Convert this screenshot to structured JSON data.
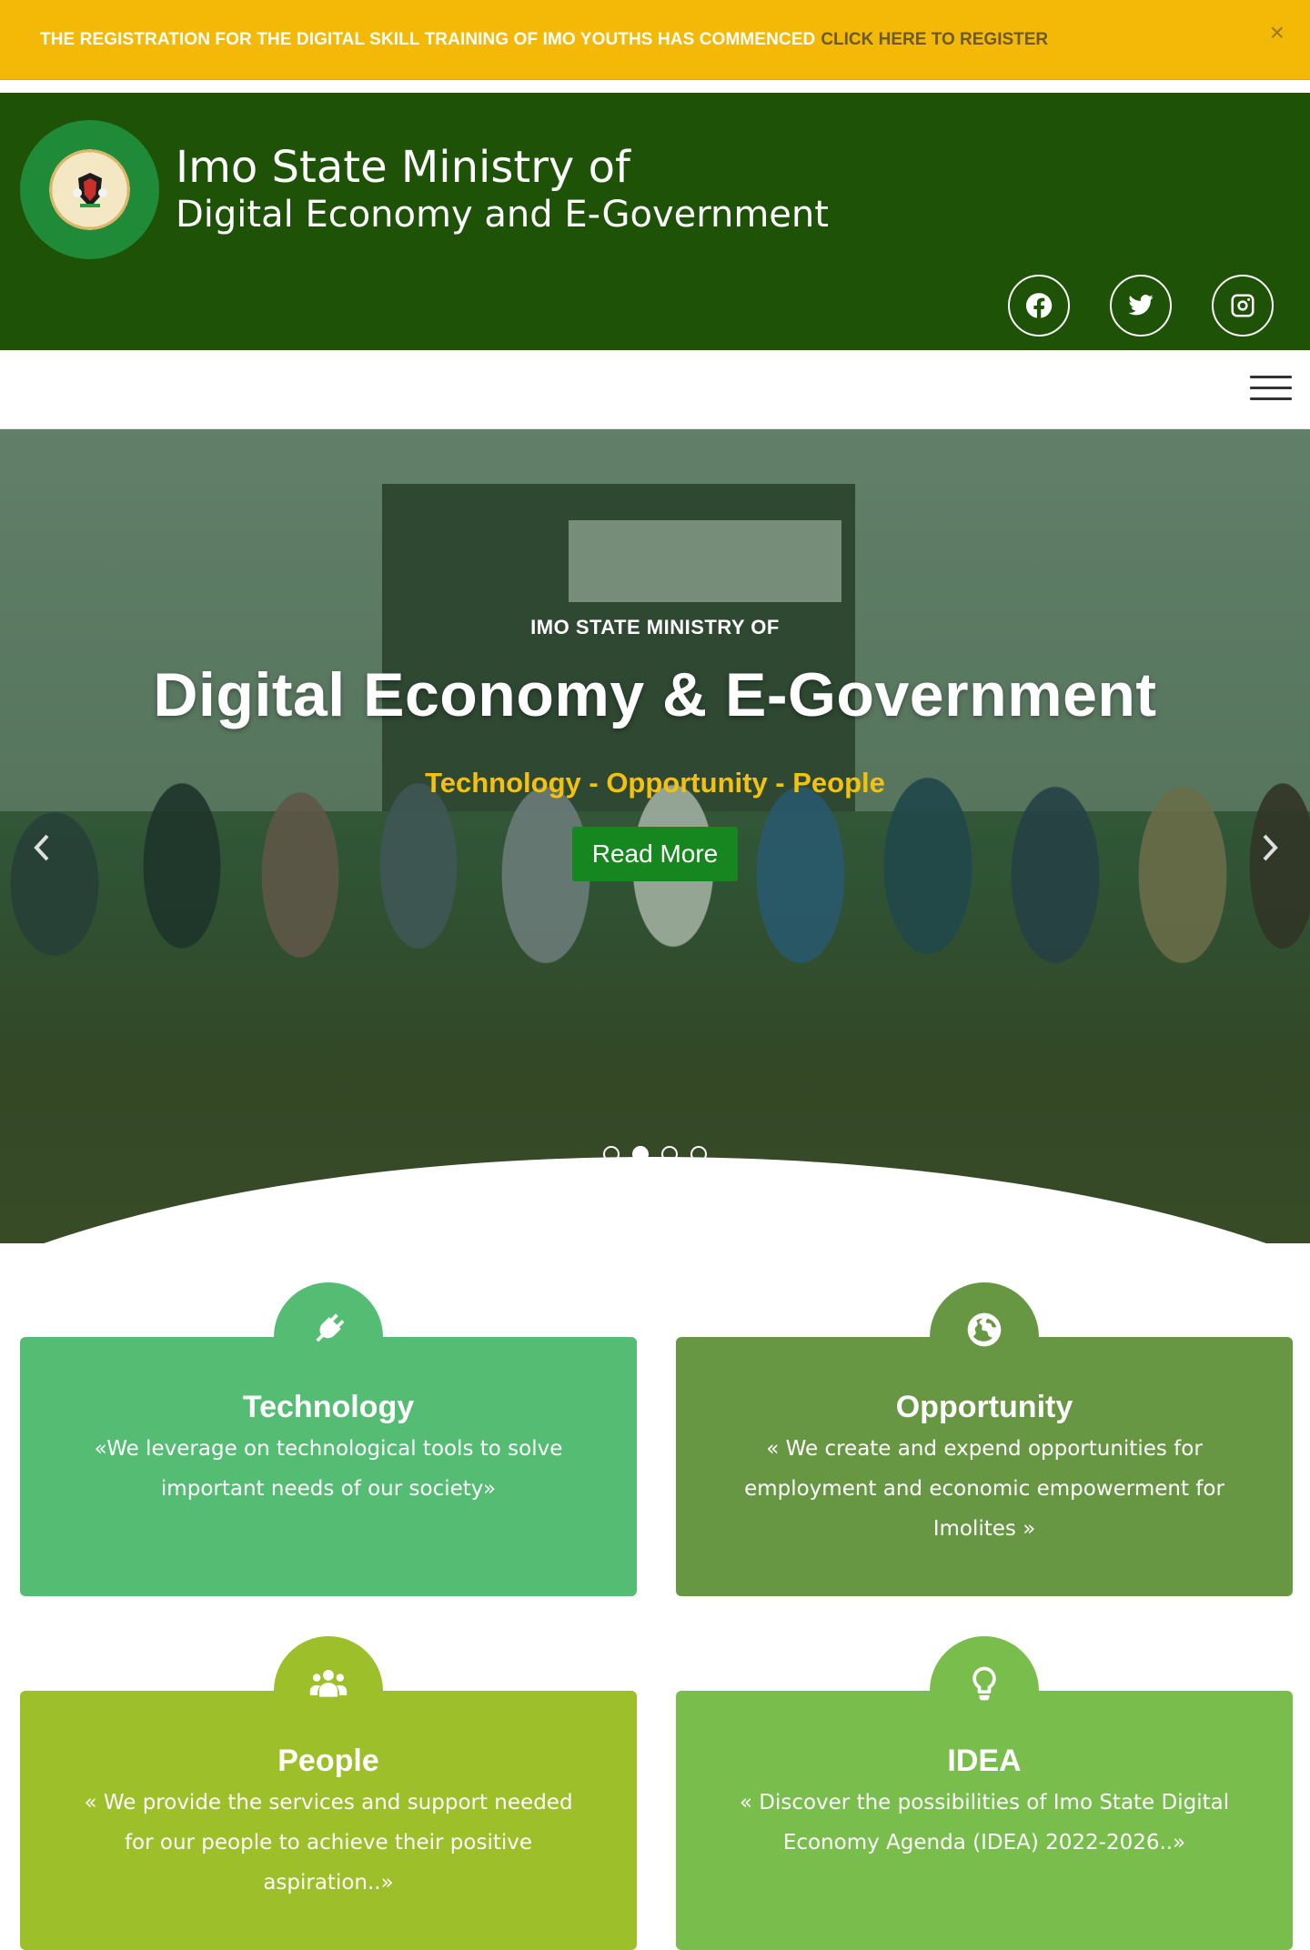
{
  "announcement": {
    "message": "THE REGISTRATION FOR THE DIGITAL SKILL TRAINING OF IMO YOUTHS HAS COMMENCED",
    "link_label": "CLICK HERE TO REGISTER",
    "close_label": "×"
  },
  "header": {
    "title_line1": "Imo State Ministry of",
    "title_line2": "Digital Economy and E-Government",
    "social": [
      "facebook-icon",
      "twitter-icon",
      "instagram-icon"
    ]
  },
  "hero": {
    "kicker": "IMO STATE MINISTRY OF",
    "title": "Digital Economy & E-Government",
    "subtitle": "Technology - Opportunity - People",
    "button_label": "Read More",
    "slides": 4,
    "active_slide": 2
  },
  "cards": [
    {
      "title": "Technology",
      "text": "«We leverage on technological tools to solve important needs of our society»",
      "color": "#55bd73",
      "icon": "plug-icon"
    },
    {
      "title": "Opportunity",
      "text": "« We create and expend opportunities for employment and economic empowerment for Imolites »",
      "color": "#689744",
      "icon": "globe-icon"
    },
    {
      "title": "People",
      "text": "« We provide the services and support needed for our people to achieve their positive aspiration..»",
      "color": "#9dbf2a",
      "icon": "users-icon"
    },
    {
      "title": "IDEA",
      "text": "« Discover the possibilities of Imo State Digital Economy Agenda (IDEA) 2022-2026..»",
      "color": "#79be4c",
      "icon": "lightbulb-icon"
    }
  ],
  "colors": {
    "announcement_bg": "#f4b806",
    "header_bg": "#1e5206",
    "button_green": "#16861f",
    "accent_yellow": "#f4c20d"
  }
}
